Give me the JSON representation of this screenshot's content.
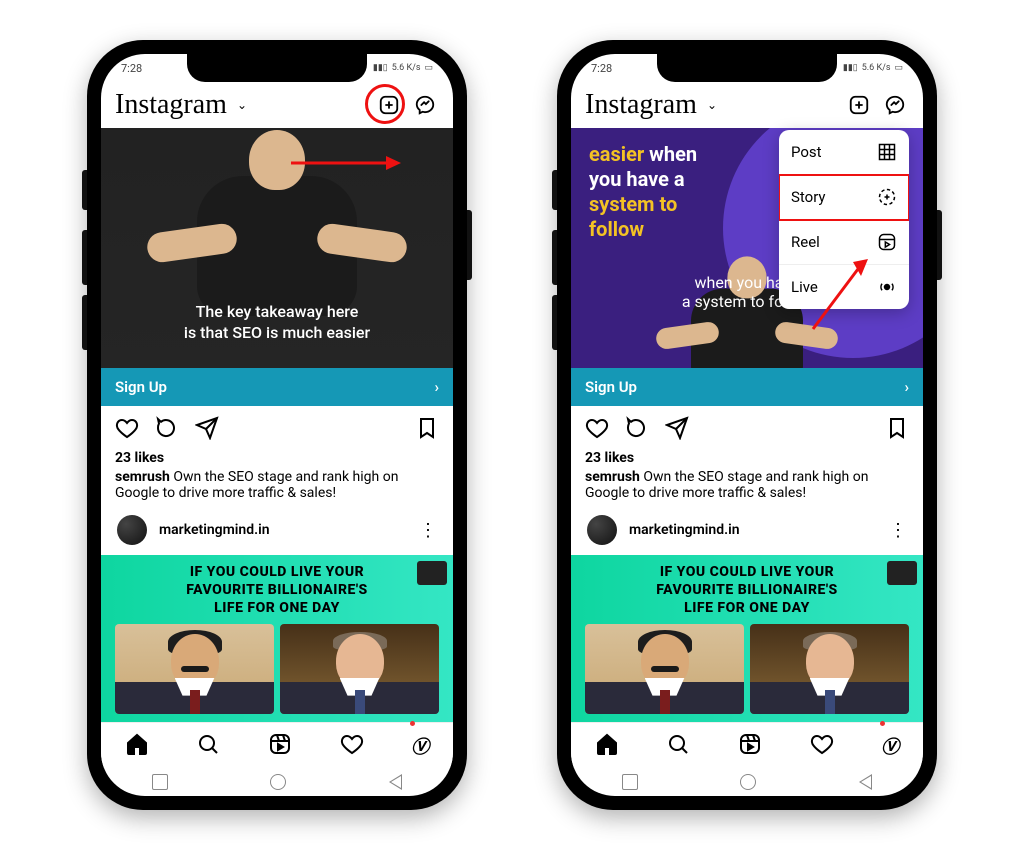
{
  "status": {
    "time": "7:28",
    "net": "5.6 K/s"
  },
  "header": {
    "logo": "Instagram"
  },
  "post1a": {
    "caption_l1": "The key takeaway here",
    "caption_l2": "is that SEO is much easier"
  },
  "post1b": {
    "w1": "easier",
    "w2": " when",
    "w3": "you have a",
    "w4": "system to",
    "w5": "follow",
    "sub_l1": "when you have",
    "sub_l2": "a system to follow"
  },
  "signup": {
    "label": "Sign Up"
  },
  "post_meta": {
    "likes": "23 likes",
    "user": "semrush",
    "caption": " Own the SEO stage and rank high on Google to drive more traffic & sales!"
  },
  "account2": "marketingmind.in",
  "post2": {
    "l1": "IF YOU COULD LIVE YOUR",
    "l2": "FAVOURITE BILLIONAIRE'S",
    "l3": "LIFE FOR ONE DAY"
  },
  "create_menu": {
    "items": [
      {
        "label": "Post"
      },
      {
        "label": "Story"
      },
      {
        "label": "Reel"
      },
      {
        "label": "Live"
      }
    ]
  },
  "colors": {
    "accent_red": "#e11",
    "teal": "#1598b6"
  }
}
